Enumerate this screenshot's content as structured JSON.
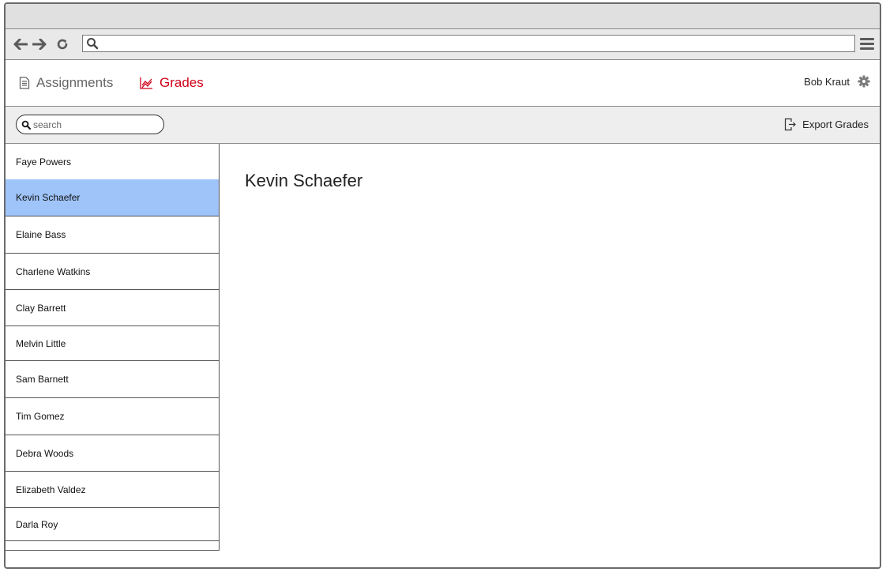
{
  "browser": {
    "url": "",
    "icons": [
      "back-arrow-icon",
      "forward-arrow-icon",
      "reload-icon",
      "search-icon",
      "hamburger-menu-icon"
    ]
  },
  "nav": {
    "tabs": [
      {
        "label": "Assignments",
        "icon": "document-icon",
        "active": false
      },
      {
        "label": "Grades",
        "icon": "chart-icon",
        "active": true
      }
    ],
    "user_name": "Bob Kraut",
    "accent_color": "#d0021b"
  },
  "toolbar": {
    "search_placeholder": "search",
    "export_label": "Export Grades"
  },
  "students": [
    {
      "name": "Faye Powers",
      "selected": false
    },
    {
      "name": "Kevin Schaefer",
      "selected": true
    },
    {
      "name": "Elaine Bass",
      "selected": false
    },
    {
      "name": "Charlene Watkins",
      "selected": false
    },
    {
      "name": "Clay Barrett",
      "selected": false
    },
    {
      "name": "Melvin Little",
      "selected": false
    },
    {
      "name": "Sam Barnett",
      "selected": false
    },
    {
      "name": "Tim Gomez",
      "selected": false
    },
    {
      "name": "Debra Woods",
      "selected": false
    },
    {
      "name": "Elizabeth Valdez",
      "selected": false
    },
    {
      "name": "Darla Roy",
      "selected": false
    }
  ],
  "selection_color": "#9fc4f9",
  "detail": {
    "title": "Kevin Schaefer"
  }
}
